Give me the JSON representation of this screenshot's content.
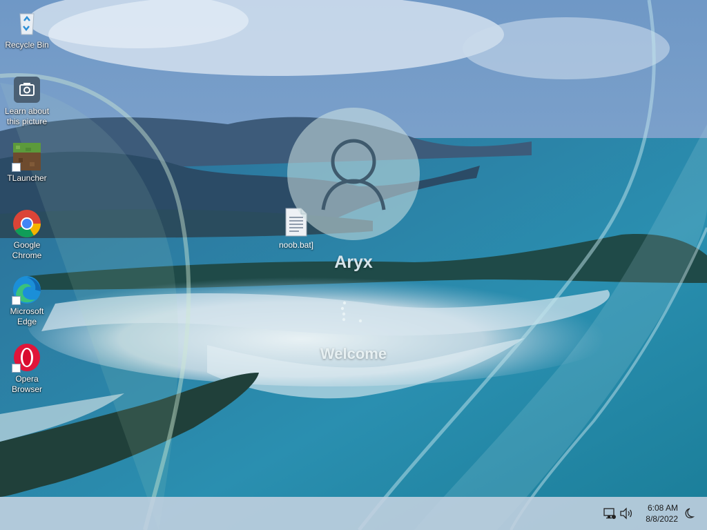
{
  "desktop": {
    "icons": [
      {
        "label": "Recycle Bin",
        "icon": "recycle-bin-icon"
      },
      {
        "label": "Learn about\nthis picture",
        "icon": "camera-icon"
      },
      {
        "label": "TLauncher",
        "icon": "minecraft-block-icon"
      },
      {
        "label": "Google\nChrome",
        "icon": "chrome-icon"
      },
      {
        "label": "Microsoft\nEdge",
        "icon": "edge-icon"
      },
      {
        "label": "Opera\nBrowser",
        "icon": "opera-icon"
      }
    ],
    "file": {
      "label": "noob.bat]",
      "icon": "batch-file-icon"
    }
  },
  "lock": {
    "username": "Aryx",
    "status": "Welcome",
    "avatar_icon": "user-icon",
    "spinner_icon": "loading-spinner-icon"
  },
  "taskbar": {
    "time": "6:08 AM",
    "date": "8/8/2022",
    "tray_icons": [
      "network-icon",
      "volume-icon",
      "moon-icon"
    ]
  },
  "colors": {
    "sea": "#1f7ea3",
    "sand": "#d8e6ee",
    "taskbar": "#c4d2e0",
    "chrome_red": "#db4437",
    "chrome_green": "#0f9d58",
    "chrome_yellow": "#f4b400",
    "chrome_blue": "#4285f4",
    "opera_red": "#e0153a",
    "edge_blue": "#1b8fd8",
    "edge_green": "#3ac27c"
  }
}
